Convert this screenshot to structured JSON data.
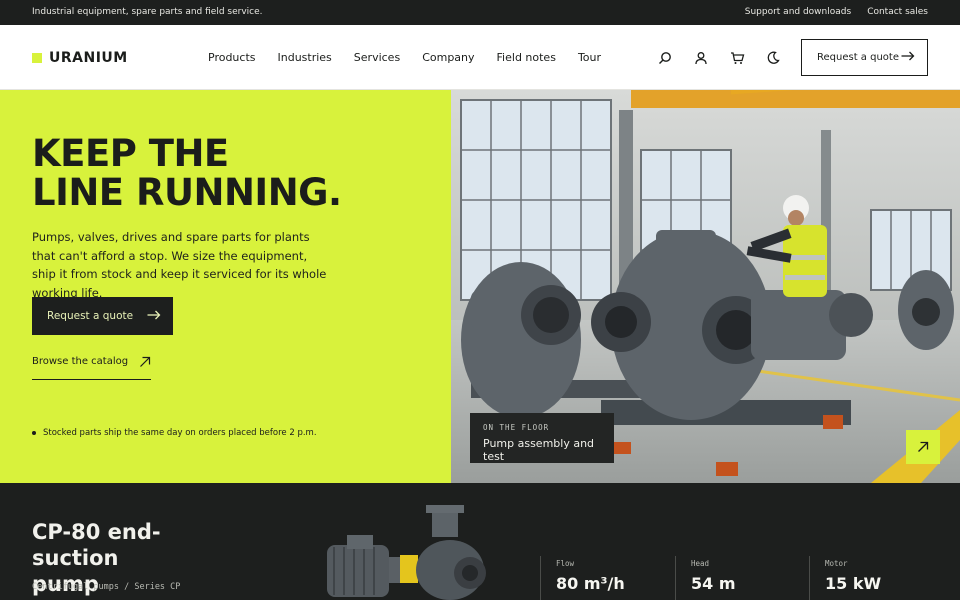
{
  "topbar": {
    "tagline": "Industrial equipment, spare parts and field service.",
    "links": [
      "Support and downloads",
      "Contact sales"
    ]
  },
  "header": {
    "logo": "URANIUM",
    "nav": [
      "Products",
      "Industries",
      "Services",
      "Company",
      "Field notes",
      "Tour"
    ],
    "icons": [
      "search-icon",
      "user-icon",
      "cart-icon",
      "moon-icon"
    ],
    "quote_button": "Request a quote"
  },
  "hero": {
    "title": "KEEP THE\nLINE RUNNING.",
    "subtitle": "Pumps, valves, drives and spare parts for plants that can't afford a stop. We size the equipment, ship it from stock and keep it serviced for its whole working life.",
    "cta": "Request a quote",
    "browse": "Browse the catalog",
    "note": "Stocked parts ship the same day on orders placed before 2 p.m.",
    "image_caption": {
      "eyebrow": "ON THE FLOOR",
      "title": "Pump assembly and test"
    }
  },
  "product": {
    "name": "CP-80 end-\nsuction pump",
    "category": "Centrifugal pumps / Series CP",
    "specs": [
      {
        "label": "Flow",
        "value": "80 m³/h"
      },
      {
        "label": "Head",
        "value": "54 m"
      },
      {
        "label": "Motor",
        "value": "15 kW"
      }
    ]
  },
  "colors": {
    "accent": "#d8f23c",
    "dark": "#1d1f1e",
    "text": "#1b1d1b"
  }
}
